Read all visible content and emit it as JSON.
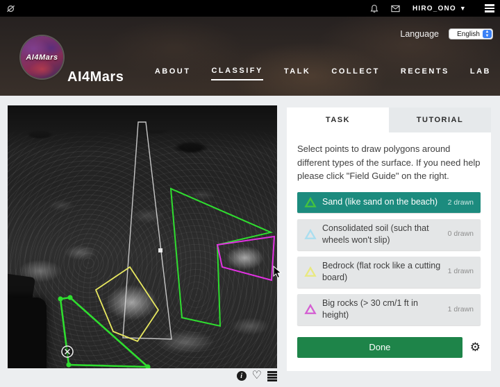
{
  "topbar": {
    "username": "HIRO_ONO"
  },
  "header": {
    "title": "AI4Mars",
    "logo_text": "AI4Mars",
    "language_label": "Language",
    "language_value": "English",
    "nav": [
      {
        "label": "ABOUT"
      },
      {
        "label": "CLASSIFY",
        "active": true
      },
      {
        "label": "TALK"
      },
      {
        "label": "COLLECT"
      },
      {
        "label": "RECENTS"
      },
      {
        "label": "LAB"
      }
    ]
  },
  "task_panel": {
    "tabs": [
      {
        "label": "TASK",
        "active": true
      },
      {
        "label": "TUTORIAL"
      }
    ],
    "instructions": "Select points to draw polygons around different types of the surface. If you need help please click \"Field Guide\" on the right.",
    "tools": [
      {
        "label": "Sand (like sand on the beach)",
        "count": "2 drawn",
        "color": "#45c33e",
        "selected": true
      },
      {
        "label": "Consolidated soil (such that wheels won't slip)",
        "count": "0 drawn",
        "color": "#a9def0",
        "selected": false
      },
      {
        "label": "Bedrock (flat rock like a cutting board)",
        "count": "1 drawn",
        "color": "#e9e97f",
        "selected": false
      },
      {
        "label": "Big rocks (> 30 cm/1 ft in height)",
        "count": "1 drawn",
        "color": "#d45ed2",
        "selected": false
      }
    ],
    "done_label": "Done"
  },
  "annotation_colors": {
    "sand": "#2fdd2f",
    "bedrock": "#e8e860",
    "big_rocks": "#e232e2",
    "in_progress": "#d9d9d9"
  }
}
